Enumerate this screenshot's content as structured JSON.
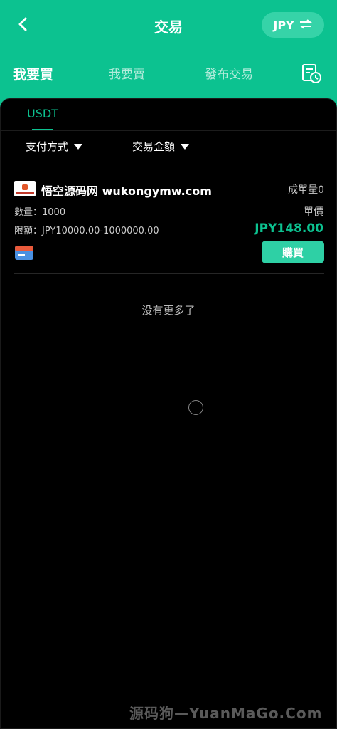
{
  "header": {
    "title": "交易",
    "currency": "JPY",
    "tabs": [
      "我要買",
      "我要賣",
      "發布交易"
    ]
  },
  "coin_tab": "USDT",
  "filters": {
    "payment_method": "支付方式",
    "amount": "交易金額"
  },
  "listing": {
    "merchant": "悟空源码网 wukongymw.com",
    "completed": "成單量0",
    "quantity": "數量：1000",
    "unit_price_label": "單價",
    "limit": "限額：JPY10000.00-1000000.00",
    "price": "JPY148.00",
    "buy_label": "購買"
  },
  "no_more": "没有更多了",
  "watermark": "源码狗—YuanMaGo.Com",
  "colors": {
    "brand": "#0cc290",
    "button": "#2ed0a5",
    "background": "#000000"
  },
  "icons": [
    "back-icon",
    "swap-icon",
    "history-icon",
    "payment-card-icon"
  ]
}
